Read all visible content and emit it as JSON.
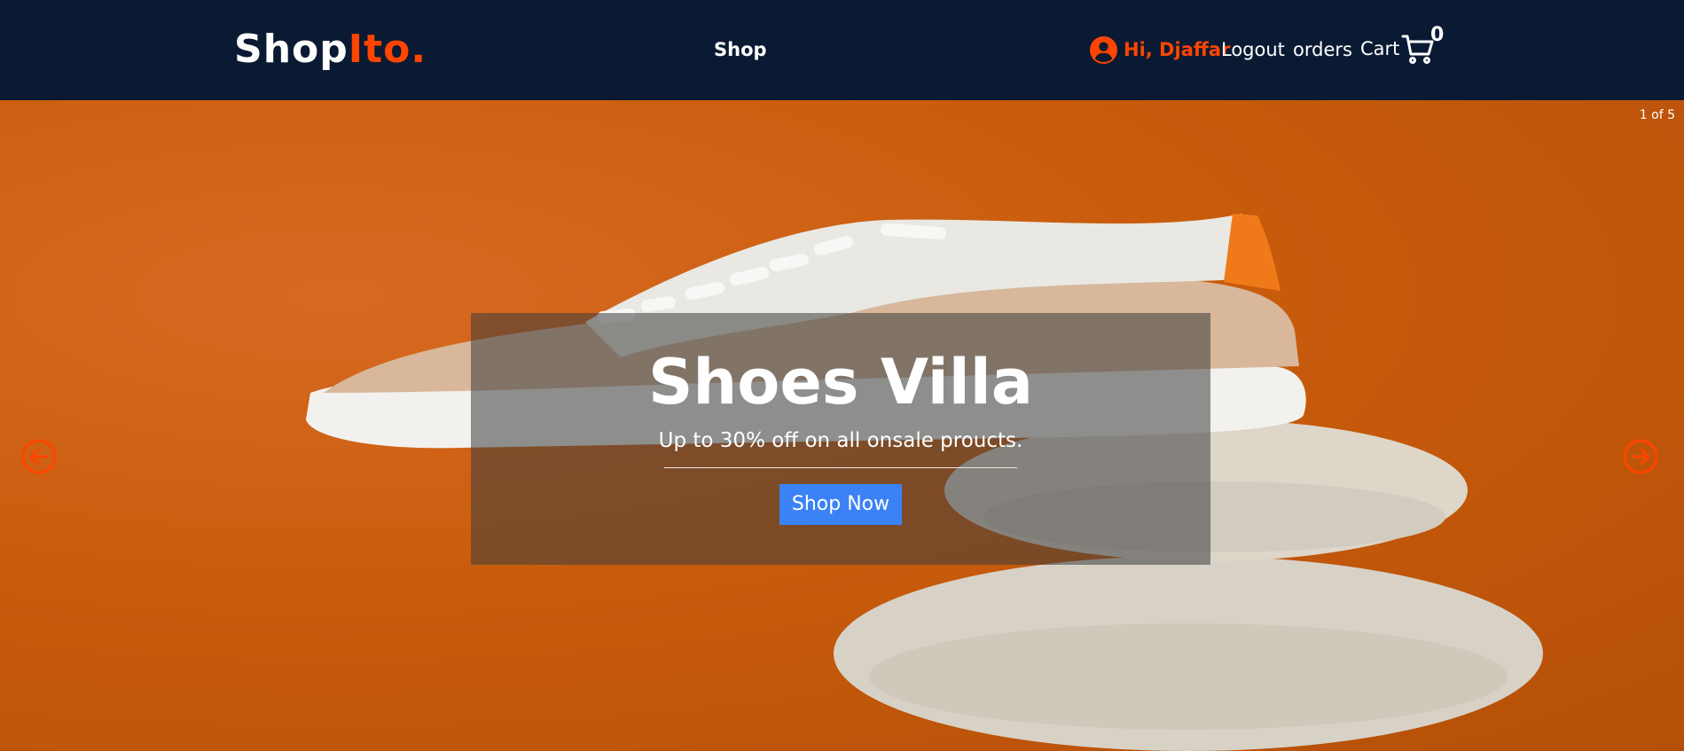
{
  "header": {
    "logo_main": "Shop",
    "logo_accent": "Ito",
    "logo_dot": ".",
    "nav_shop": "Shop",
    "greeting": "Hi, Djaffar",
    "logout": "Logout",
    "orders": "orders",
    "cart": "Cart",
    "cart_count": "0"
  },
  "slider": {
    "counter": "1 of 5",
    "title": "Shoes Villa",
    "subtitle": "Up to 30% off on all onsale proucts.",
    "cta_label": "Shop Now"
  },
  "colors": {
    "header_bg": "#0b1a33",
    "accent": "#ff4500",
    "cta_bg": "#3b82f6"
  },
  "icons": [
    "user-circle-icon",
    "cart-icon",
    "arrow-left-circle-icon",
    "arrow-right-circle-icon"
  ]
}
